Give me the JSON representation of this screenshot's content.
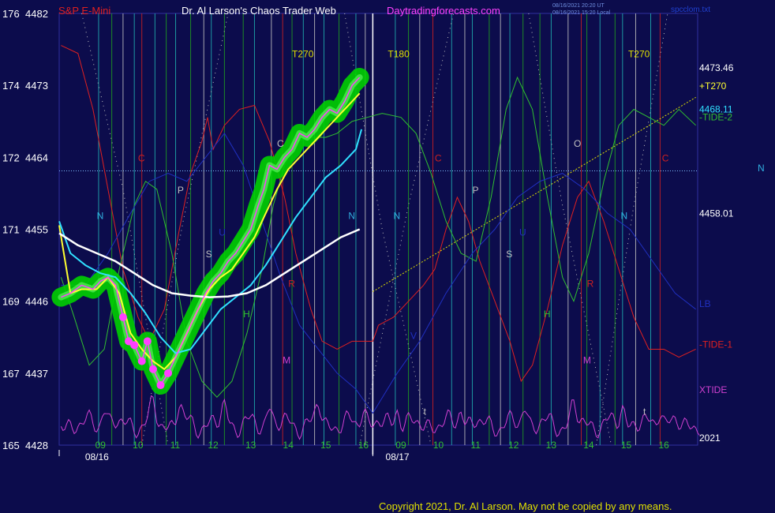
{
  "header": {
    "symbol": "S&P E-Mini",
    "title": "Dr. Al Larson's Chaos Trader Web",
    "site": "Daytradingforecasts.com",
    "timestamp1": "08/16/2021 20:20 UT",
    "timestamp2": "08/16/2021 15:20 Local",
    "file": "spcclom.txt"
  },
  "copyright": "Copyright 2021, Dr. Al Larson. May not be copied by any means.",
  "colors": {
    "background": "#0c0c4c",
    "price_glow": "#00d000",
    "price_line": "#ff40ff",
    "fast_avg": "#ffff30",
    "mid_avg": "#30e0ff",
    "slow_avg": "#ffffff",
    "tide1": "#e02020",
    "tide2": "#30c030",
    "xtide": "#d040d0",
    "lb": "#2030c0",
    "grid_cyan": "#20b0b0",
    "grid_green": "#20a020",
    "grid_red": "#d02020",
    "grid_white": "#c0c0c0"
  },
  "chart_data": {
    "type": "line",
    "y_axis": {
      "ticks": [
        {
          "left": "176",
          "right": "4482",
          "value": 4482
        },
        {
          "left": "174",
          "right": "4473",
          "value": 4473
        },
        {
          "left": "172",
          "right": "4464",
          "value": 4464
        },
        {
          "left": "171",
          "right": "4455",
          "value": 4455
        },
        {
          "left": "169",
          "right": "4446",
          "value": 4446
        },
        {
          "left": "167",
          "right": "4437",
          "value": 4437
        },
        {
          "left": "165",
          "right": "4428",
          "value": 4428
        }
      ],
      "ylim": [
        4428,
        4482
      ]
    },
    "x_axis": {
      "xlim": [
        8,
        25
      ],
      "hour_labels": [
        {
          "x": 9,
          "label": "09"
        },
        {
          "x": 10,
          "label": "10"
        },
        {
          "x": 11,
          "label": "11"
        },
        {
          "x": 12,
          "label": "12"
        },
        {
          "x": 13,
          "label": "13"
        },
        {
          "x": 14,
          "label": "14"
        },
        {
          "x": 15,
          "label": "15"
        },
        {
          "x": 16,
          "label": "16"
        },
        {
          "x": 17,
          "label": "09"
        },
        {
          "x": 18,
          "label": "10"
        },
        {
          "x": 19,
          "label": "11"
        },
        {
          "x": 20,
          "label": "12"
        },
        {
          "x": 21,
          "label": "13"
        },
        {
          "x": 22,
          "label": "14"
        },
        {
          "x": 23,
          "label": "15"
        },
        {
          "x": 24,
          "label": "16"
        }
      ],
      "date_labels": [
        {
          "x": 8.9,
          "label": "08/16"
        },
        {
          "x": 16.9,
          "label": "08/17"
        }
      ]
    },
    "series": [
      {
        "key": "price",
        "points": [
          [
            8.05,
            4446.5
          ],
          [
            8.3,
            4447
          ],
          [
            8.6,
            4448
          ],
          [
            8.9,
            4447.5
          ],
          [
            9.1,
            4448.5
          ],
          [
            9.3,
            4449
          ],
          [
            9.5,
            4448
          ],
          [
            9.7,
            4444
          ],
          [
            9.85,
            4441
          ],
          [
            10.0,
            4440.5
          ],
          [
            10.2,
            4438.5
          ],
          [
            10.35,
            4441
          ],
          [
            10.5,
            4437.5
          ],
          [
            10.7,
            4435.5
          ],
          [
            10.9,
            4437
          ],
          [
            11.1,
            4439
          ],
          [
            11.3,
            4441
          ],
          [
            11.5,
            4443
          ],
          [
            11.7,
            4445
          ],
          [
            11.9,
            4447
          ],
          [
            12.1,
            4448.5
          ],
          [
            12.3,
            4449.5
          ],
          [
            12.5,
            4451
          ],
          [
            12.7,
            4452
          ],
          [
            12.9,
            4453.5
          ],
          [
            13.1,
            4455
          ],
          [
            13.3,
            4458
          ],
          [
            13.45,
            4460
          ],
          [
            13.6,
            4463
          ],
          [
            13.8,
            4462.5
          ],
          [
            14.0,
            4464
          ],
          [
            14.2,
            4465
          ],
          [
            14.4,
            4467
          ],
          [
            14.6,
            4466.5
          ],
          [
            14.8,
            4467.5
          ],
          [
            15.0,
            4469
          ],
          [
            15.2,
            4470
          ],
          [
            15.4,
            4469.5
          ],
          [
            15.6,
            4471
          ],
          [
            15.8,
            4473
          ],
          [
            16.0,
            4474
          ]
        ]
      },
      {
        "key": "fast_avg",
        "name": "",
        "points": [
          [
            8.0,
            4455.5
          ],
          [
            8.3,
            4447
          ],
          [
            8.6,
            4447.5
          ],
          [
            9.0,
            4447.5
          ],
          [
            9.3,
            4449
          ],
          [
            9.6,
            4447
          ],
          [
            9.9,
            4442
          ],
          [
            10.2,
            4440
          ],
          [
            10.5,
            4438.5
          ],
          [
            10.8,
            4437.5
          ],
          [
            11.1,
            4439
          ],
          [
            11.4,
            4442
          ],
          [
            11.7,
            4445
          ],
          [
            12.0,
            4447.5
          ],
          [
            12.3,
            4449
          ],
          [
            12.6,
            4450
          ],
          [
            12.9,
            4452
          ],
          [
            13.2,
            4454
          ],
          [
            13.5,
            4457
          ],
          [
            13.8,
            4460
          ],
          [
            14.1,
            4462.5
          ],
          [
            14.4,
            4464
          ],
          [
            14.7,
            4465.5
          ],
          [
            15.0,
            4467
          ],
          [
            15.3,
            4468.5
          ],
          [
            15.6,
            4470
          ],
          [
            16.0,
            4472
          ]
        ]
      },
      {
        "key": "mid_avg",
        "name": "",
        "points": [
          [
            8.0,
            4456
          ],
          [
            8.3,
            4452
          ],
          [
            8.7,
            4450.5
          ],
          [
            9.1,
            4449.5
          ],
          [
            9.5,
            4449
          ],
          [
            9.9,
            4447
          ],
          [
            10.3,
            4444.5
          ],
          [
            10.7,
            4441.5
          ],
          [
            11.1,
            4439.5
          ],
          [
            11.5,
            4440
          ],
          [
            11.9,
            4442.5
          ],
          [
            12.3,
            4445
          ],
          [
            12.7,
            4446.5
          ],
          [
            13.1,
            4448
          ],
          [
            13.5,
            4450.5
          ],
          [
            13.9,
            4453.5
          ],
          [
            14.3,
            4456.5
          ],
          [
            14.7,
            4459
          ],
          [
            15.1,
            4461.5
          ],
          [
            15.5,
            4463
          ],
          [
            15.9,
            4465
          ],
          [
            16.05,
            4467.5
          ]
        ]
      },
      {
        "key": "slow_avg",
        "name": "",
        "points": [
          [
            8.0,
            4454.5
          ],
          [
            8.5,
            4453
          ],
          [
            9.0,
            4452
          ],
          [
            9.5,
            4451
          ],
          [
            10.0,
            4449.5
          ],
          [
            10.5,
            4448
          ],
          [
            11.0,
            4447
          ],
          [
            11.5,
            4446.7
          ],
          [
            12.0,
            4446.5
          ],
          [
            12.5,
            4446.6
          ],
          [
            13.0,
            4447
          ],
          [
            13.5,
            4448
          ],
          [
            14.0,
            4449.5
          ],
          [
            14.5,
            4451
          ],
          [
            15.0,
            4452.5
          ],
          [
            15.5,
            4454
          ],
          [
            16.0,
            4455
          ]
        ]
      }
    ],
    "annotations": [
      {
        "x": 14.2,
        "y": 4476.5,
        "text": "T270",
        "color": "#e0e000"
      },
      {
        "x": 16.75,
        "y": 4476.5,
        "text": "T180",
        "color": "#e0e000"
      },
      {
        "x": 23.15,
        "y": 4476.5,
        "text": "T270",
        "color": "#e0e000"
      },
      {
        "x": 9.0,
        "y": 4456.3,
        "text": "N",
        "color": "#30b0e0"
      },
      {
        "x": 15.7,
        "y": 4456.3,
        "text": "N",
        "color": "#30b0e0"
      },
      {
        "x": 16.9,
        "y": 4456.3,
        "text": "N",
        "color": "#30b0e0"
      },
      {
        "x": 22.95,
        "y": 4456.3,
        "text": "N",
        "color": "#30b0e0"
      },
      {
        "x": 11.15,
        "y": 4459.5,
        "text": "P",
        "color": "#c0c0c0"
      },
      {
        "x": 19.0,
        "y": 4459.5,
        "text": "P",
        "color": "#c0c0c0"
      },
      {
        "x": 13.8,
        "y": 4465.3,
        "text": "C",
        "color": "#c0c0c0"
      },
      {
        "x": 21.7,
        "y": 4465.3,
        "text": "O",
        "color": "#c0c0c0"
      },
      {
        "x": 10.1,
        "y": 4463.5,
        "text": "C",
        "color": "#d02020"
      },
      {
        "x": 18.0,
        "y": 4463.5,
        "text": "C",
        "color": "#d02020"
      },
      {
        "x": 24.05,
        "y": 4463.5,
        "text": "C",
        "color": "#d02020"
      },
      {
        "x": 11.9,
        "y": 4451.5,
        "text": "S",
        "color": "#c0c0c0"
      },
      {
        "x": 19.9,
        "y": 4451.5,
        "text": "S",
        "color": "#c0c0c0"
      },
      {
        "x": 12.25,
        "y": 4454.2,
        "text": "U",
        "color": "#2030c0"
      },
      {
        "x": 20.25,
        "y": 4454.2,
        "text": "U",
        "color": "#2030c0"
      },
      {
        "x": 14.1,
        "y": 4447.8,
        "text": "R",
        "color": "#d02020"
      },
      {
        "x": 22.05,
        "y": 4447.8,
        "text": "R",
        "color": "#d02020"
      },
      {
        "x": 12.9,
        "y": 4444,
        "text": "H",
        "color": "#30c030"
      },
      {
        "x": 20.9,
        "y": 4444,
        "text": "H",
        "color": "#30c030"
      },
      {
        "x": 13.95,
        "y": 4438.2,
        "text": "M",
        "color": "#d040d0"
      },
      {
        "x": 21.95,
        "y": 4438.2,
        "text": "M",
        "color": "#d040d0"
      },
      {
        "x": 17.7,
        "y": 4431.8,
        "text": "t",
        "color": "#c0c0c0"
      },
      {
        "x": 23.55,
        "y": 4431.8,
        "text": "t",
        "color": "#c0c0c0"
      },
      {
        "x": 17.35,
        "y": 4441.3,
        "text": "V",
        "color": "#2030c0"
      }
    ],
    "right_labels": [
      {
        "text": "4473.46",
        "color": "#ffffff",
        "y": 4474.8
      },
      {
        "text": "+T270",
        "color": "#ffff30",
        "y": 4472.5
      },
      {
        "text": "4468.11",
        "color": "#30e0ff",
        "y": 4469.6
      },
      {
        "text": "-TIDE-2",
        "color": "#30c030",
        "y": 4468.6
      },
      {
        "text": "4458.01",
        "color": "#ffffff",
        "y": 4456.6
      },
      {
        "text": "LB",
        "color": "#2030c0",
        "y": 4445.3
      },
      {
        "text": "-TIDE-1",
        "color": "#e02020",
        "y": 4440.2
      },
      {
        "text": "XTIDE",
        "color": "#d040d0",
        "y": 4434.5
      },
      {
        "text": "2021",
        "color": "#ffffff",
        "y": 4428.5
      }
    ],
    "edge_label": {
      "text": "N",
      "color": "#30b0e0"
    }
  }
}
